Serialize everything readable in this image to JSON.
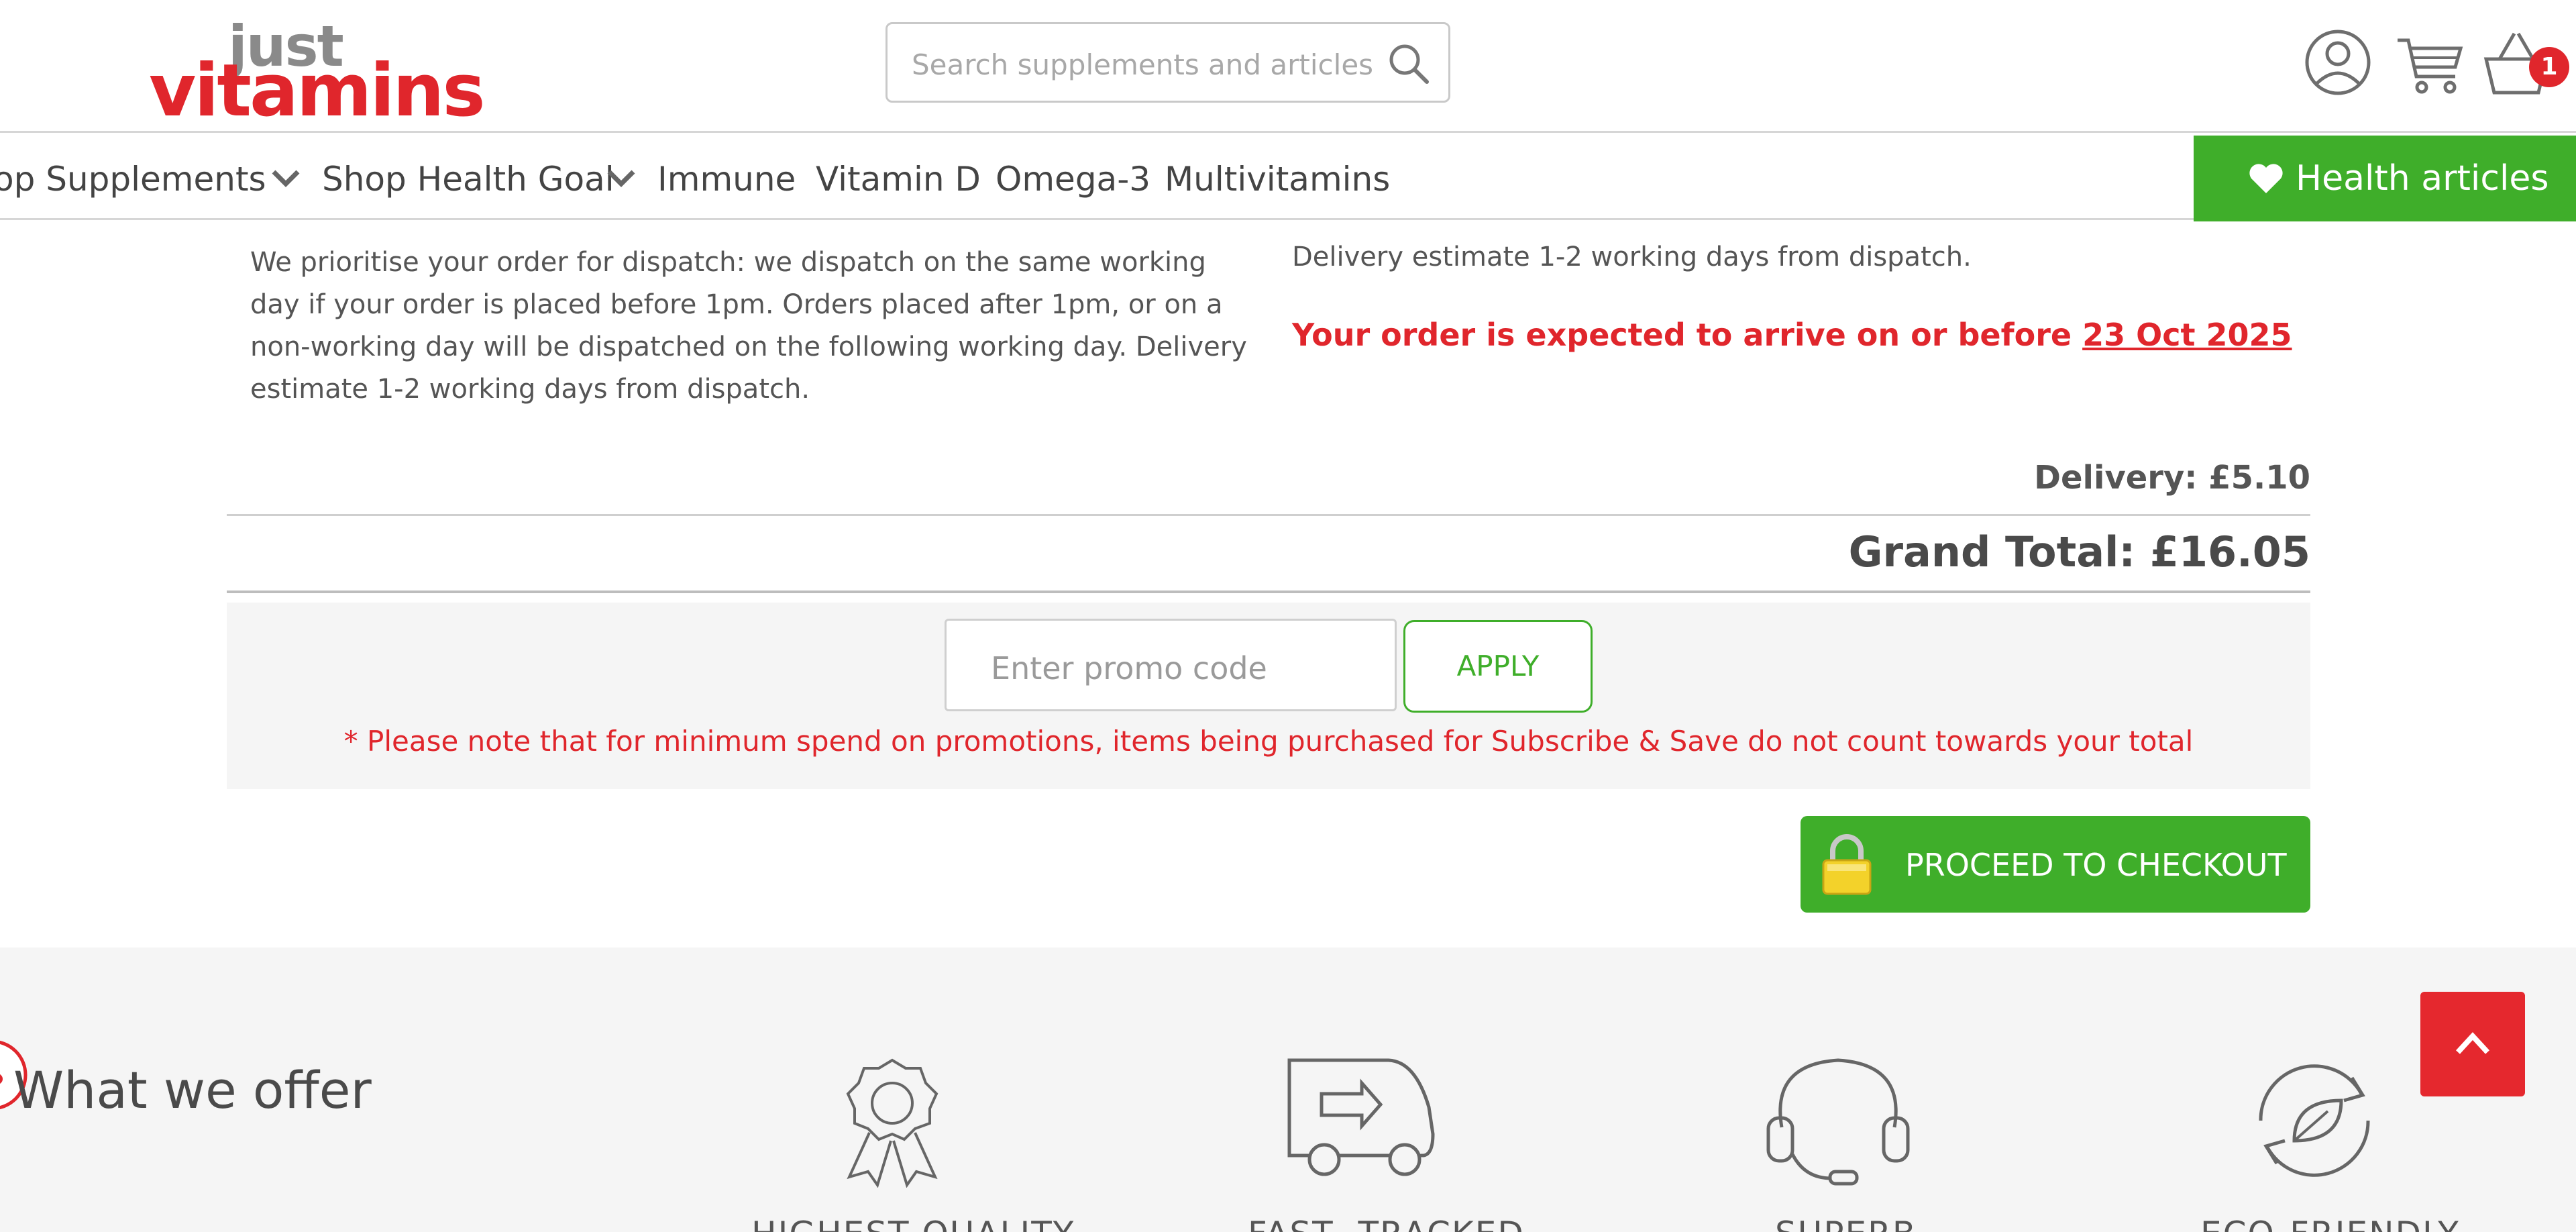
{
  "header": {
    "logo_top": "just",
    "logo_bottom": "vitamins",
    "search_placeholder": "Search supplements and articles",
    "basket_count": "1"
  },
  "nav": {
    "items": [
      "op Supplements",
      "Shop Health Goal",
      "Immune",
      "Vitamin D",
      "Omega-3",
      "Multivitamins"
    ],
    "health_articles": "Health articles"
  },
  "delivery_info": {
    "dispatch_text": "We prioritise your order for dispatch: we dispatch on the same working day if your order is placed before 1pm. Orders placed after 1pm, or on a non-working day will be dispatched on the following working day. Delivery estimate 1-2 working days from dispatch.",
    "estimate_text": "Delivery estimate 1-2 working days from dispatch.",
    "arrive_prefix": "Your order is expected to arrive on or before ",
    "arrive_date": "23 Oct 2025"
  },
  "totals": {
    "delivery": "Delivery: £5.10",
    "grand_total": "Grand Total: £16.05"
  },
  "promo": {
    "placeholder": "Enter promo code",
    "apply_label": "APPLY",
    "note": "* Please note that for minimum spend on promotions, items being purchased for Subscribe & Save do not count towards your total"
  },
  "checkout_label": "PROCEED TO CHECKOUT",
  "offer": {
    "title": "What we offer",
    "features": [
      "HIGHEST QUALITY",
      "FAST, TRACKED",
      "SUPERB",
      "ECO-FRIENDLY"
    ]
  },
  "colors": {
    "brand_red": "#e0262c",
    "brand_green": "#3fae2a"
  }
}
